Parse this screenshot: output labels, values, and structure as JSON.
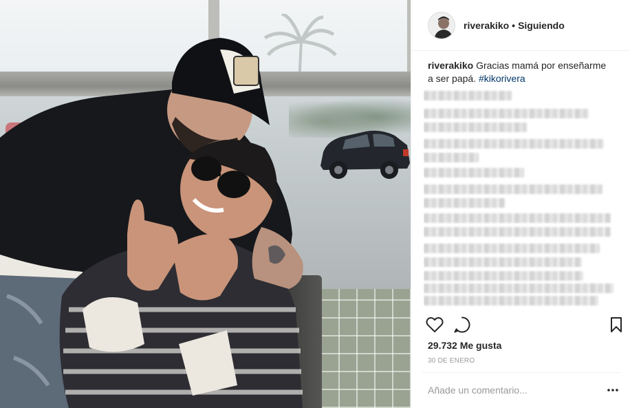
{
  "post": {
    "username": "riverakiko",
    "separator": "•",
    "follow_status": "Siguiendo",
    "caption": {
      "username": "riverakiko",
      "text": "Gracias mamá por enseñarme a ser papá.",
      "hashtag": "#kikorivera"
    },
    "likes_text": "29.732 Me gusta",
    "date": "30 DE ENERO",
    "comment_placeholder": "Añade un comentario..."
  },
  "icons": {
    "like": "heart-icon",
    "comment": "comment-bubble-icon",
    "save": "bookmark-icon",
    "more": "more-options-icon"
  },
  "colors": {
    "text": "#262626",
    "muted": "#999999",
    "hashtag": "#003569",
    "divider": "#efefef"
  }
}
